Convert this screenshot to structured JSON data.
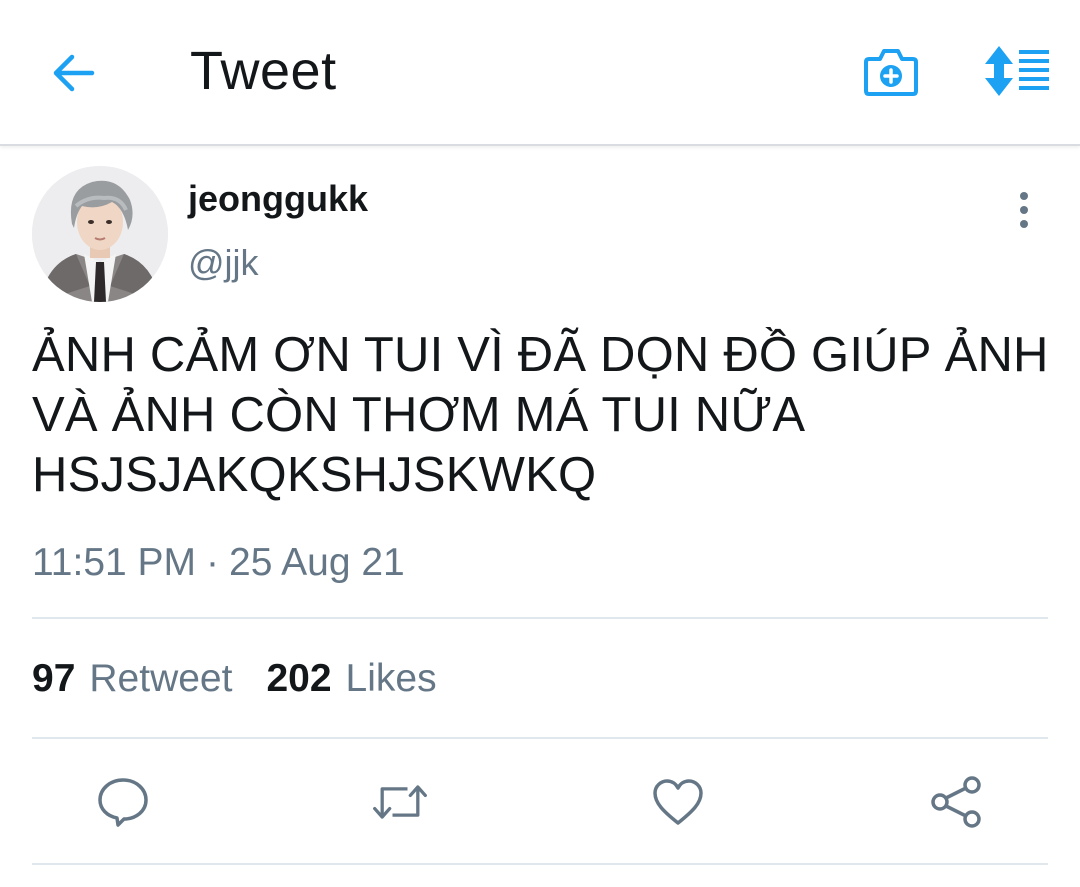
{
  "header": {
    "title": "Tweet",
    "back_icon": "arrow-left-icon",
    "camera_icon": "camera-plus-icon",
    "sort_icon": "sort-lines-icon",
    "accent_color": "#1da1f2"
  },
  "tweet": {
    "display_name": "jeonggukk",
    "handle": "@jjk",
    "text": "ẢNH CẢM ƠN TUI VÌ ĐÃ DỌN ĐỒ GIÚP ẢNH\nVÀ ẢNH CÒN THƠM MÁ TUI NỮA\nHSJSJAKQKSHJSKWKQ",
    "time": "11:51 PM",
    "separator": "·",
    "date": "25 Aug 21",
    "more_icon": "more-vertical-icon"
  },
  "stats": {
    "retweets_count": "97",
    "retweets_label": "Retweet",
    "likes_count": "202",
    "likes_label": "Likes"
  },
  "actions": {
    "reply_icon": "reply-bubble-icon",
    "retweet_icon": "retweet-icon",
    "like_icon": "heart-icon",
    "share_icon": "share-icon"
  },
  "colors": {
    "text_primary": "#14171a",
    "text_secondary": "#657786",
    "divider": "#e1e8ed"
  }
}
